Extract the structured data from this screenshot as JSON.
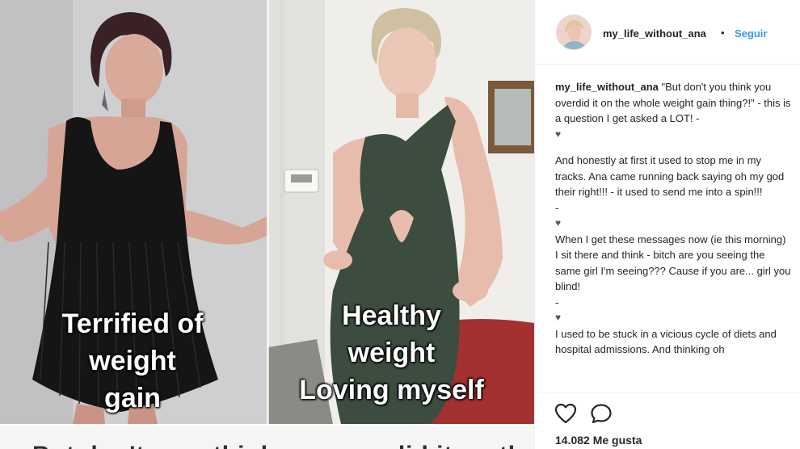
{
  "photo": {
    "left_caption": [
      "Terrified of",
      "weight",
      "gain"
    ],
    "right_caption": [
      "Healthy",
      "weight",
      "Loving myself"
    ],
    "bottom_text": "But don't ever think you overdid it on the"
  },
  "post": {
    "username": "my_life_without_ana",
    "dot": "•",
    "follow_label": "Seguir",
    "caption_blocks": [
      {
        "type": "text",
        "user": "my_life_without_ana",
        "text": "\"But don't you think you overdid it on the whole weight gain thing?!\" - this is a question I get asked a LOT! -"
      },
      {
        "type": "heart"
      },
      {
        "type": "gap"
      },
      {
        "type": "text",
        "text": "And honestly at first it used to stop me in my tracks. Ana came running back saying oh my god their right!!! - it used to send me into a spin!!!"
      },
      {
        "type": "text",
        "text": "-"
      },
      {
        "type": "heart"
      },
      {
        "type": "text",
        "text": "When I get these messages now (ie this morning) I sit there and think - bitch are you seeing the same girl I'm seeing??? Cause if you are... girl you blind!"
      },
      {
        "type": "text",
        "text": "-"
      },
      {
        "type": "heart"
      },
      {
        "type": "text",
        "text": "I used to be stuck in a vicious cycle of diets and hospital admissions. And thinking oh"
      }
    ],
    "likes_label": "14.082 Me gusta"
  },
  "icons": {
    "like": "heart-outline-icon",
    "comment": "speech-bubble-icon"
  },
  "colors": {
    "link_blue": "#3897f0",
    "text": "#262626",
    "border": "#efefef"
  }
}
